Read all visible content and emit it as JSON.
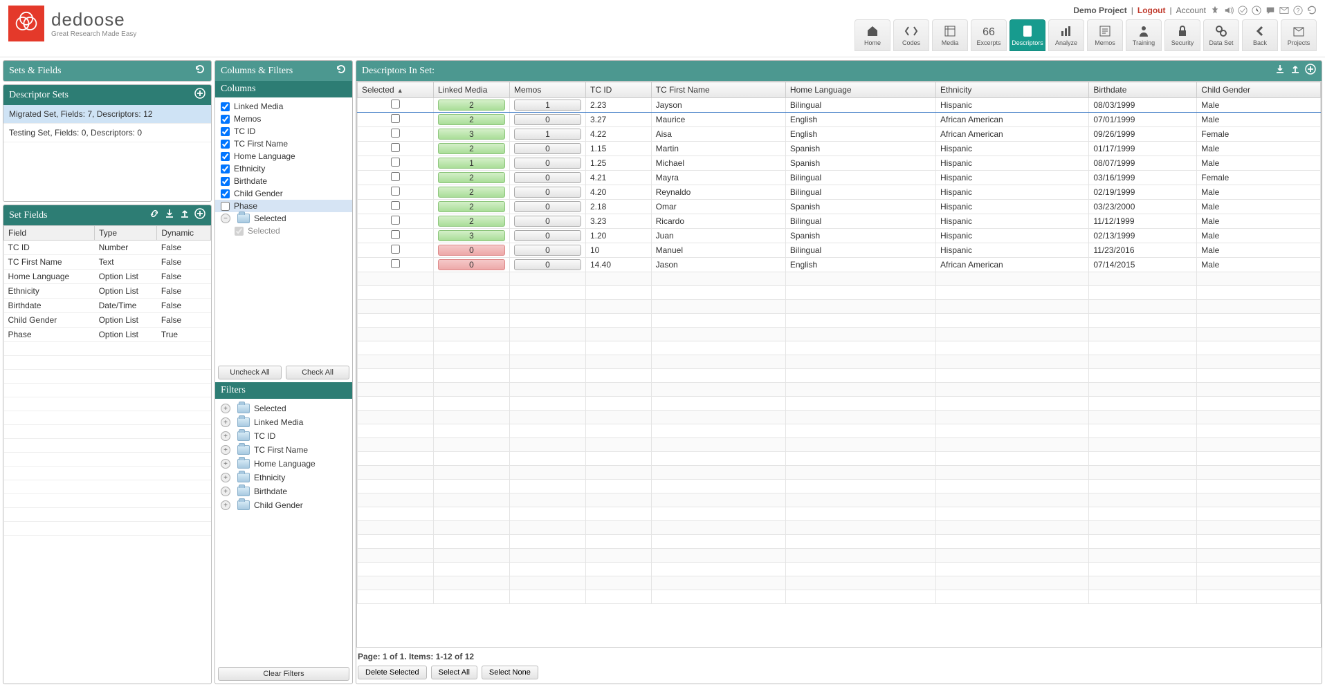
{
  "header": {
    "brand": "dedoose",
    "tagline": "Great Research Made Easy",
    "project_label": "Demo Project",
    "logout": "Logout",
    "account": "Account",
    "nav": [
      {
        "id": "home",
        "label": "Home"
      },
      {
        "id": "codes",
        "label": "Codes"
      },
      {
        "id": "media",
        "label": "Media"
      },
      {
        "id": "excerpts",
        "label": "Excerpts"
      },
      {
        "id": "descriptors",
        "label": "Descriptors",
        "active": true
      },
      {
        "id": "analyze",
        "label": "Analyze"
      },
      {
        "id": "memos",
        "label": "Memos"
      },
      {
        "id": "training",
        "label": "Training"
      },
      {
        "id": "security",
        "label": "Security"
      },
      {
        "id": "dataset",
        "label": "Data Set"
      },
      {
        "id": "back",
        "label": "Back"
      },
      {
        "id": "projects",
        "label": "Projects"
      }
    ]
  },
  "left": {
    "sets_fields_title": "Sets & Fields",
    "descriptor_sets_title": "Descriptor Sets",
    "sets": [
      {
        "label": "Migrated Set, Fields: 7, Descriptors: 12",
        "selected": true
      },
      {
        "label": "Testing Set, Fields: 0, Descriptors: 0",
        "selected": false
      }
    ],
    "set_fields_title": "Set Fields",
    "field_headers": {
      "field": "Field",
      "type": "Type",
      "dynamic": "Dynamic"
    },
    "fields": [
      {
        "field": "TC ID",
        "type": "Number",
        "dynamic": "False"
      },
      {
        "field": "TC First Name",
        "type": "Text",
        "dynamic": "False"
      },
      {
        "field": "Home Language",
        "type": "Option List",
        "dynamic": "False"
      },
      {
        "field": "Ethnicity",
        "type": "Option List",
        "dynamic": "False"
      },
      {
        "field": "Birthdate",
        "type": "Date/Time",
        "dynamic": "False"
      },
      {
        "field": "Child Gender",
        "type": "Option List",
        "dynamic": "False"
      },
      {
        "field": "Phase",
        "type": "Option List",
        "dynamic": "True"
      }
    ]
  },
  "mid": {
    "columns_filters_title": "Columns & Filters",
    "columns_title": "Columns",
    "columns": [
      {
        "label": "Linked Media",
        "checked": true
      },
      {
        "label": "Memos",
        "checked": true
      },
      {
        "label": "TC ID",
        "checked": true
      },
      {
        "label": "TC First Name",
        "checked": true
      },
      {
        "label": "Home Language",
        "checked": true
      },
      {
        "label": "Ethnicity",
        "checked": true
      },
      {
        "label": "Birthdate",
        "checked": true
      },
      {
        "label": "Child Gender",
        "checked": true
      },
      {
        "label": "Phase",
        "checked": false,
        "highlight": true
      }
    ],
    "selected_sub": "Selected",
    "selected_child": "Selected",
    "uncheck_all": "Uncheck All",
    "check_all": "Check All",
    "filters_title": "Filters",
    "filters": [
      "Selected",
      "Linked Media",
      "TC ID",
      "TC First Name",
      "Home Language",
      "Ethnicity",
      "Birthdate",
      "Child Gender"
    ],
    "clear_filters": "Clear Filters"
  },
  "right": {
    "title": "Descriptors In Set:",
    "headers": [
      "Selected",
      "Linked Media",
      "Memos",
      "TC ID",
      "TC First Name",
      "Home Language",
      "Ethnicity",
      "Birthdate",
      "Child Gender"
    ],
    "rows": [
      {
        "lm": "2",
        "lmc": "green",
        "memos": "1",
        "tcid": "2.23",
        "name": "Jayson",
        "lang": "Bilingual",
        "eth": "Hispanic",
        "bd": "08/03/1999",
        "gender": "Male"
      },
      {
        "lm": "2",
        "lmc": "green",
        "memos": "0",
        "tcid": "3.27",
        "name": "Maurice",
        "lang": "English",
        "eth": "African American",
        "bd": "07/01/1999",
        "gender": "Male"
      },
      {
        "lm": "3",
        "lmc": "green",
        "memos": "1",
        "tcid": "4.22",
        "name": "Aisa",
        "lang": "English",
        "eth": "African American",
        "bd": "09/26/1999",
        "gender": "Female"
      },
      {
        "lm": "2",
        "lmc": "green",
        "memos": "0",
        "tcid": "1.15",
        "name": "Martin",
        "lang": "Spanish",
        "eth": "Hispanic",
        "bd": "01/17/1999",
        "gender": "Male"
      },
      {
        "lm": "1",
        "lmc": "green",
        "memos": "0",
        "tcid": "1.25",
        "name": "Michael",
        "lang": "Spanish",
        "eth": "Hispanic",
        "bd": "08/07/1999",
        "gender": "Male"
      },
      {
        "lm": "2",
        "lmc": "green",
        "memos": "0",
        "tcid": "4.21",
        "name": "Mayra",
        "lang": "Bilingual",
        "eth": "Hispanic",
        "bd": "03/16/1999",
        "gender": "Female"
      },
      {
        "lm": "2",
        "lmc": "green",
        "memos": "0",
        "tcid": "4.20",
        "name": "Reynaldo",
        "lang": "Bilingual",
        "eth": "Hispanic",
        "bd": "02/19/1999",
        "gender": "Male"
      },
      {
        "lm": "2",
        "lmc": "green",
        "memos": "0",
        "tcid": "2.18",
        "name": "Omar",
        "lang": "Spanish",
        "eth": "Hispanic",
        "bd": "03/23/2000",
        "gender": "Male"
      },
      {
        "lm": "2",
        "lmc": "green",
        "memos": "0",
        "tcid": "3.23",
        "name": "Ricardo",
        "lang": "Bilingual",
        "eth": "Hispanic",
        "bd": "11/12/1999",
        "gender": "Male"
      },
      {
        "lm": "3",
        "lmc": "green",
        "memos": "0",
        "tcid": "1.20",
        "name": "Juan",
        "lang": "Spanish",
        "eth": "Hispanic",
        "bd": "02/13/1999",
        "gender": "Male"
      },
      {
        "lm": "0",
        "lmc": "red",
        "memos": "0",
        "tcid": "10",
        "name": "Manuel",
        "lang": "Bilingual",
        "eth": "Hispanic",
        "bd": "11/23/2016",
        "gender": "Male"
      },
      {
        "lm": "0",
        "lmc": "red",
        "memos": "0",
        "tcid": "14.40",
        "name": "Jason",
        "lang": "English",
        "eth": "African American",
        "bd": "07/14/2015",
        "gender": "Male"
      }
    ],
    "page_info": "Page: 1 of 1. Items: 1-12 of 12",
    "delete_selected": "Delete Selected",
    "select_all": "Select All",
    "select_none": "Select None"
  }
}
